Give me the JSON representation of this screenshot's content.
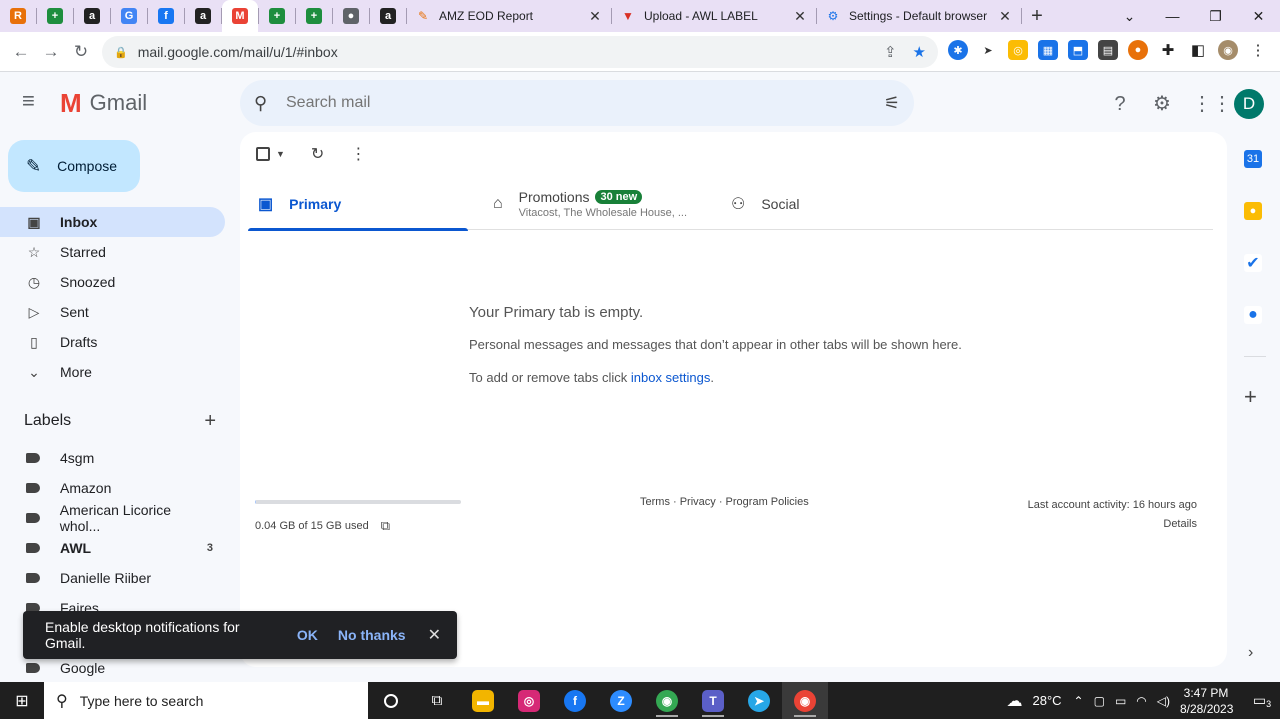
{
  "browser": {
    "pinned_tabs": [
      {
        "icon": "r-square-icon",
        "color": "#e8710a",
        "glyph": "R"
      },
      {
        "icon": "plus-sheet-icon",
        "color": "#1e8e3e",
        "glyph": "+"
      },
      {
        "icon": "amazon-icon",
        "color": "#222222",
        "glyph": "a"
      },
      {
        "icon": "google-icon",
        "color": "#4285f4",
        "glyph": "G"
      },
      {
        "icon": "facebook-icon",
        "color": "#1877f2",
        "glyph": "f"
      },
      {
        "icon": "amazon-icon",
        "color": "#222222",
        "glyph": "a"
      },
      {
        "icon": "gmail-icon",
        "color": "#ea4335",
        "glyph": "M"
      },
      {
        "icon": "plus-sheet-icon",
        "color": "#1e8e3e",
        "glyph": "+"
      },
      {
        "icon": "plus-sheet-icon",
        "color": "#1e8e3e",
        "glyph": "+"
      },
      {
        "icon": "globe-icon",
        "color": "#5f6368",
        "glyph": "●"
      },
      {
        "icon": "amazon-icon",
        "color": "#222222",
        "glyph": "a"
      }
    ],
    "tabs": [
      {
        "title": "AMZ EOD Report",
        "icon": "pen-icon",
        "color": "#e8710a",
        "glyph": "✎"
      },
      {
        "title": "Upload - AWL LABEL",
        "icon": "vivaldi-icon",
        "color": "#d93025",
        "glyph": "▼"
      },
      {
        "title": "Settings - Default browser",
        "icon": "gear-icon",
        "color": "#1a73e8",
        "glyph": "⚙"
      }
    ],
    "url": "mail.google.com/mail/u/1/#inbox"
  },
  "gmail": {
    "brand": "Gmail",
    "search_placeholder": "Search mail",
    "avatar_initial": "D",
    "compose_label": "Compose",
    "nav": [
      {
        "label": "Inbox",
        "icon": "inbox-icon",
        "glyph": "▣",
        "selected": true
      },
      {
        "label": "Starred",
        "icon": "star-icon",
        "glyph": "☆"
      },
      {
        "label": "Snoozed",
        "icon": "clock-icon",
        "glyph": "◷"
      },
      {
        "label": "Sent",
        "icon": "send-icon",
        "glyph": "▷"
      },
      {
        "label": "Drafts",
        "icon": "draft-icon",
        "glyph": "▯"
      },
      {
        "label": "More",
        "icon": "chevron-down-icon",
        "glyph": "⌄"
      }
    ],
    "labels_heading": "Labels",
    "labels": [
      {
        "name": "4sgm",
        "count": ""
      },
      {
        "name": "Amazon",
        "count": ""
      },
      {
        "name": "American Licorice whol...",
        "count": ""
      },
      {
        "name": "AWL",
        "count": "3",
        "bold": true
      },
      {
        "name": "Danielle Riiber",
        "count": ""
      },
      {
        "name": "Faires",
        "count": ""
      },
      {
        "name": "",
        "count": ""
      },
      {
        "name": "Google",
        "count": ""
      }
    ],
    "tabs": {
      "primary": "Primary",
      "promotions": "Promotions",
      "promotions_badge": "30 new",
      "promotions_snippet": "Vitacost, The Wholesale House, ...",
      "social": "Social"
    },
    "empty": {
      "heading": "Your Primary tab is empty.",
      "line1": "Personal messages and messages that don’t appear in other tabs will be shown here.",
      "line2_prefix": "To add or remove tabs click ",
      "line2_link": "inbox settings",
      "line2_suffix": "."
    },
    "storage_text": "0.04 GB of 15 GB used",
    "storage_fraction": 0.003,
    "footer_links": "Terms · Privacy · Program Policies",
    "last_activity": "Last account activity: 16 hours ago",
    "details": "Details",
    "toast": {
      "message": "Enable desktop notifications for Gmail.",
      "ok": "OK",
      "no_thanks": "No thanks"
    }
  },
  "taskbar": {
    "search_placeholder": "Type here to search",
    "temperature": "28°C",
    "time": "3:47 PM",
    "date": "8/28/2023",
    "notification_count": "3"
  }
}
